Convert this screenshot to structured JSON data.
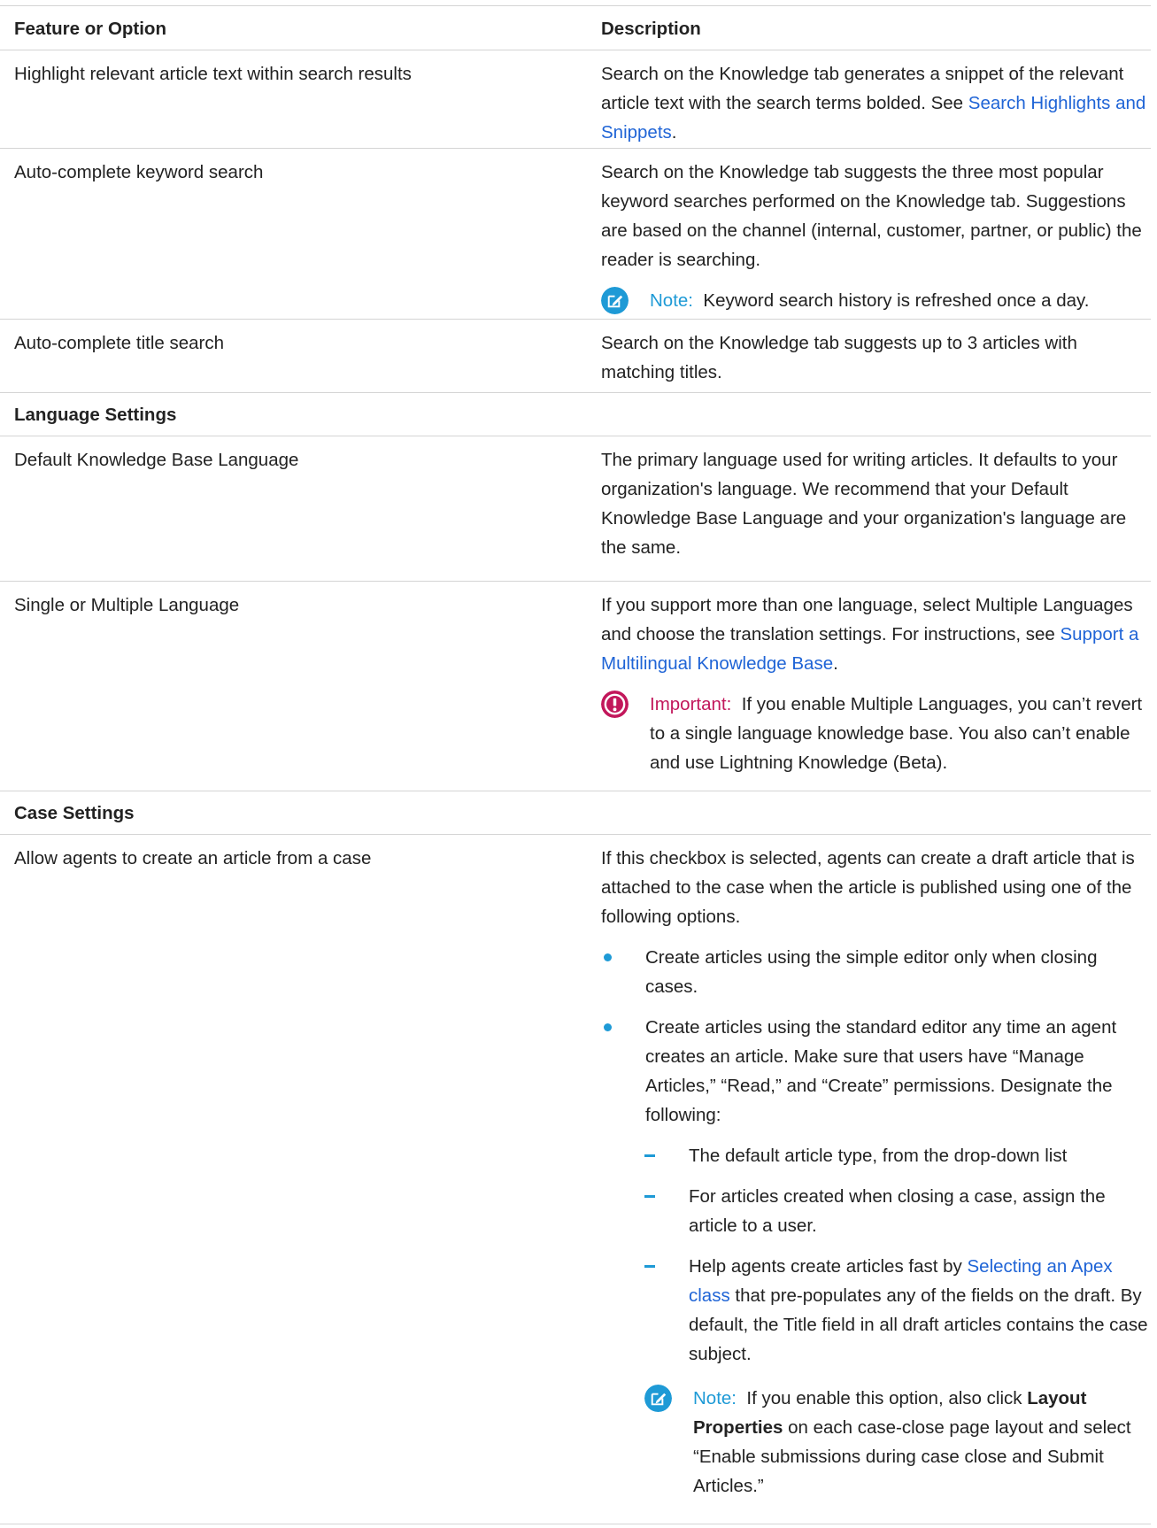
{
  "header": {
    "col1": "Feature or Option",
    "col2": "Description"
  },
  "rows": {
    "highlight": {
      "name": "Highlight relevant article text within search results",
      "desc_pre": "Search on the Knowledge tab generates a snippet of the relevant article text with the search terms bolded. See ",
      "desc_link": "Search Highlights and Snippets",
      "desc_post": "."
    },
    "autokeyword": {
      "name": "Auto-complete keyword search",
      "desc": "Search on the Knowledge tab suggests the three most popular keyword searches performed on the Knowledge tab. Suggestions are based on the channel (internal, customer, partner, or public) the reader is searching.",
      "note_label": "Note:",
      "note_text": "Keyword search history is refreshed once a day."
    },
    "autotitle": {
      "name": "Auto-complete title search",
      "desc": "Search on the Knowledge tab suggests up to 3 articles with matching titles."
    },
    "lang_section": {
      "title": "Language Settings"
    },
    "default_lang": {
      "name": "Default Knowledge Base Language",
      "desc": "The primary language used for writing articles. It defaults to your organization's language. We recommend that your Default Knowledge Base Language and your organization's language are the same."
    },
    "single_multi": {
      "name": "Single or Multiple Language",
      "desc_pre": "If you support more than one language, select Multiple Languages and choose the translation settings. For instructions, see ",
      "desc_link": "Support a Multilingual Knowledge Base",
      "desc_post": ".",
      "imp_label": "Important:",
      "imp_text": "If you enable Multiple Languages, you can’t revert to a single language knowledge base. You also can’t enable and use Lightning Knowledge (Beta)."
    },
    "case_section": {
      "title": "Case Settings"
    },
    "allow_agents": {
      "name": "Allow agents to create an article from a case",
      "desc": "If this checkbox is selected, agents can create a draft article that is attached to the case when the article is published using one of the following options.",
      "bullet1": "Create articles using the simple editor only when closing cases.",
      "bullet2": "Create articles using the standard editor any time an agent creates an article. Make sure that users have “Manage Articles,” “Read,” and “Create” permissions. Designate the following:",
      "sub1": "The default article type, from the drop-down list",
      "sub2": "For articles created when closing a case, assign the article to a user.",
      "sub3_pre": "Help agents create articles fast by ",
      "sub3_link": "Selecting an Apex class",
      "sub3_post": " that pre-populates any of the fields on the draft. By default, the Title field in all draft articles contains the case subject.",
      "note_label": "Note:",
      "note_pre": "If you enable this option, also click ",
      "note_bold": "Layout Properties",
      "note_post": " on each case-close page layout and select “Enable submissions during case close and Submit Articles.”"
    }
  },
  "colors": {
    "link": "#1f64d6",
    "note": "#1e9ad6",
    "important": "#c2175b",
    "border": "#d4d4d4"
  },
  "icons": {
    "note": "note-pencil-icon",
    "important": "exclamation-icon"
  }
}
